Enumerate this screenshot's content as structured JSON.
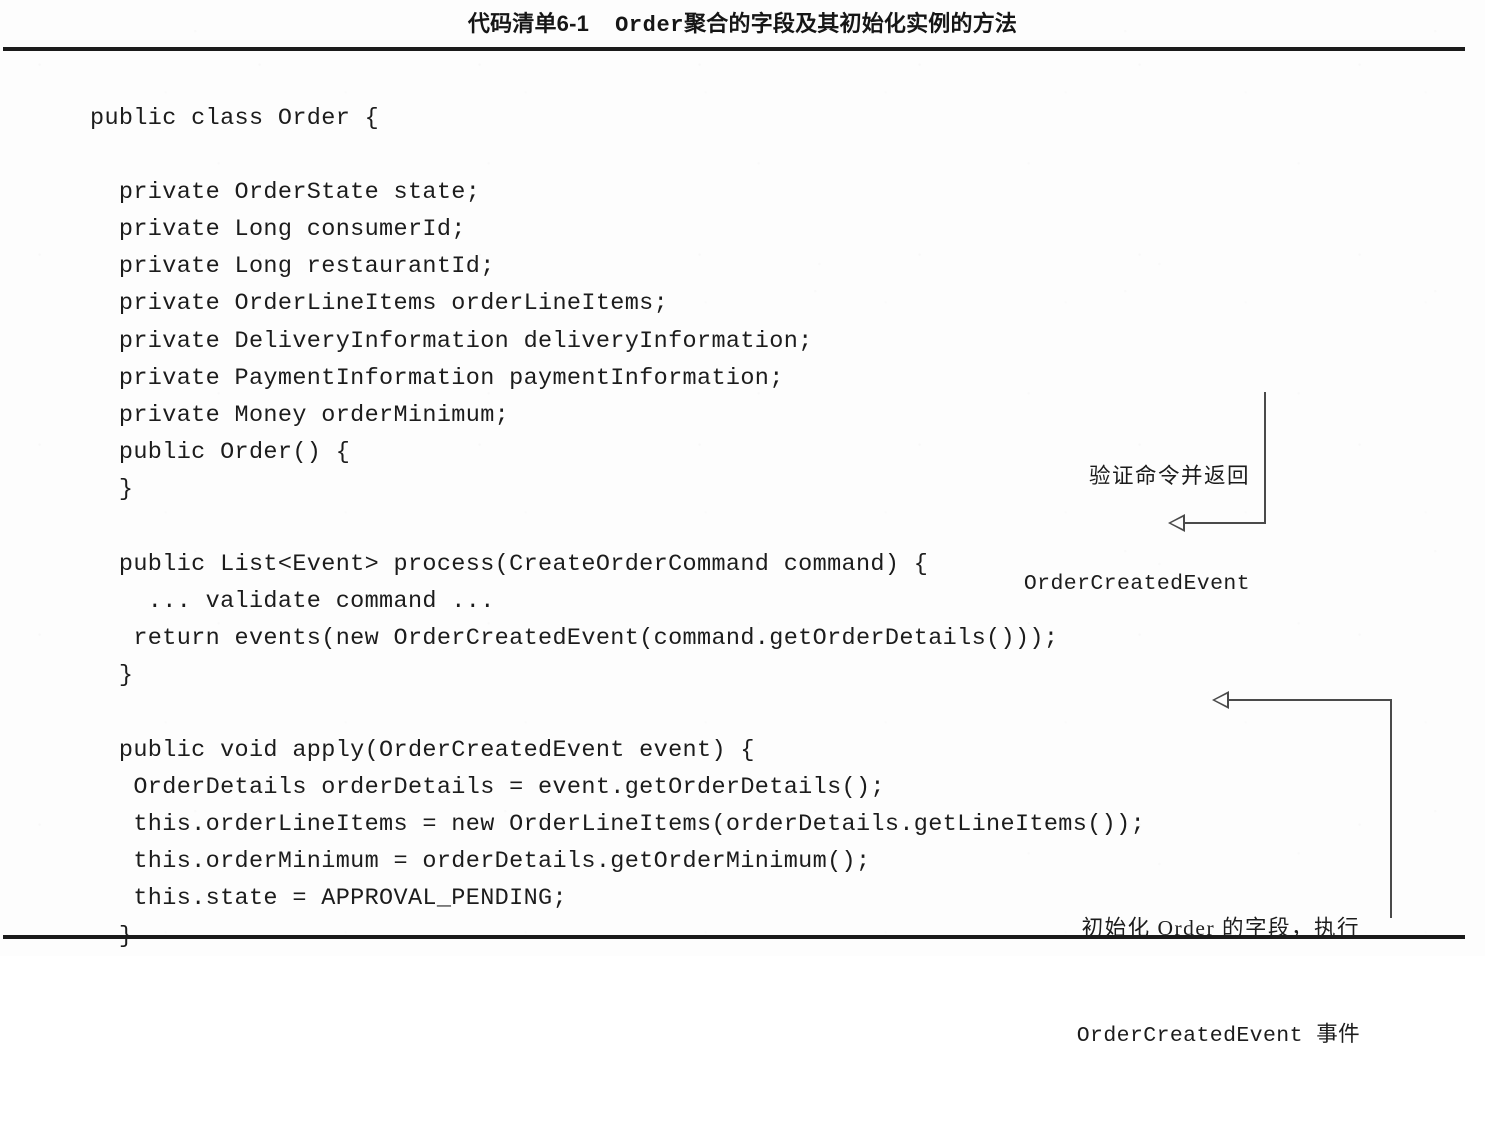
{
  "caption": {
    "listing_number": "代码清单6-1",
    "mono_term": "Order",
    "title_rest": "聚合的字段及其初始化实例的方法"
  },
  "code": {
    "language": "java",
    "lines": [
      "public class Order {",
      "",
      "  private OrderState state;",
      "  private Long consumerId;",
      "  private Long restaurantId;",
      "  private OrderLineItems orderLineItems;",
      "  private DeliveryInformation deliveryInformation;",
      "  private PaymentInformation paymentInformation;",
      "  private Money orderMinimum;",
      "  public Order() {",
      "  }",
      "",
      "  public List<Event> process(CreateOrderCommand command) {",
      "    ... validate command ...",
      "   return events(new OrderCreatedEvent(command.getOrderDetails()));",
      "  }",
      "",
      "  public void apply(OrderCreatedEvent event) {",
      "   OrderDetails orderDetails = event.getOrderDetails();",
      "   this.orderLineItems = new OrderLineItems(orderDetails.getLineItems());",
      "   this.orderMinimum = orderDetails.getOrderMinimum();",
      "   this.state = APPROVAL_PENDING;",
      "  }"
    ]
  },
  "annotations": [
    {
      "id": "annotation-validate-command",
      "line1_han": "验证命令并返回",
      "line2_mono": "OrderCreatedEvent",
      "points_to_code_line": "public List<Event> process(CreateOrderCommand command) {"
    },
    {
      "id": "annotation-initialize-fields",
      "line1_han": "初始化 Order 的字段，执行",
      "line2_mono": "OrderCreatedEvent 事件",
      "points_to_code_line": "public void apply(OrderCreatedEvent event) {"
    }
  ],
  "colors": {
    "page_background": "#fdfdfd",
    "text": "#1c1c1c",
    "rule": "#1b1b1b",
    "leader_line": "#4a4a4a"
  }
}
